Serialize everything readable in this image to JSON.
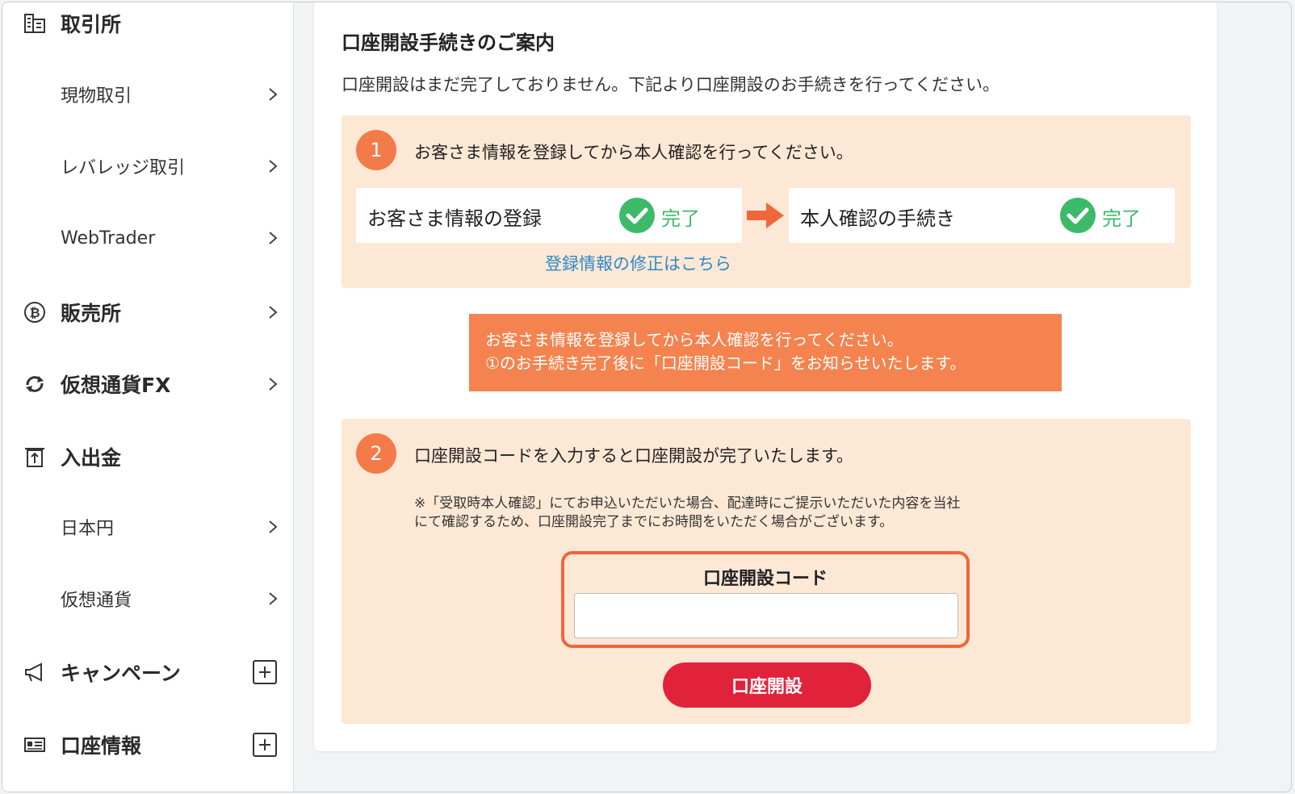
{
  "sidebar": {
    "items": [
      {
        "label": "取引所",
        "icon": "building-icon",
        "type": "section"
      },
      {
        "label": "現物取引",
        "type": "sub"
      },
      {
        "label": "レバレッジ取引",
        "type": "sub"
      },
      {
        "label": "WebTrader",
        "type": "sub"
      },
      {
        "label": "販売所",
        "icon": "bitcoin-icon",
        "type": "section"
      },
      {
        "label": "仮想通貨FX",
        "icon": "exchange-icon",
        "type": "section"
      },
      {
        "label": "入出金",
        "icon": "deposit-icon",
        "type": "section"
      },
      {
        "label": "日本円",
        "type": "sub"
      },
      {
        "label": "仮想通貨",
        "type": "sub"
      },
      {
        "label": "キャンペーン",
        "icon": "megaphone-icon",
        "type": "section-expand"
      },
      {
        "label": "口座情報",
        "icon": "id-card-icon",
        "type": "section-expand"
      }
    ]
  },
  "main": {
    "title": "口座開設手続きのご案内",
    "description": "口座開設はまだ完了しておりません。下記より口座開設のお手続きを行ってください。",
    "step1": {
      "number": "1",
      "text": "お客さま情報を登録してから本人確認を行ってください。",
      "registration": {
        "label": "お客さま情報の登録",
        "status": "完了"
      },
      "verification": {
        "label": "本人確認の手続き",
        "status": "完了"
      },
      "edit_link": "登録情報の修正はこちら"
    },
    "notice": {
      "line1": "お客さま情報を登録してから本人確認を行ってください。",
      "line2": "①のお手続き完了後に「口座開設コード」をお知らせいたします。"
    },
    "step2": {
      "number": "2",
      "text": "口座開設コードを入力すると口座開設が完了いたします。",
      "note_line1": "※「受取時本人確認」にてお申込いただいた場合、配達時にご提示いただいた内容を当社",
      "note_line2": "にて確認するため、口座開設完了までにお時間をいただく場合がございます。",
      "code_label": "口座開設コード",
      "code_value": "",
      "button_label": "口座開設"
    }
  },
  "colors": {
    "accent_orange": "#f37a49",
    "step_bg": "#fde8d5",
    "complete_green": "#3cba6a",
    "link_blue": "#2e89c6",
    "button_red": "#e0233a"
  }
}
